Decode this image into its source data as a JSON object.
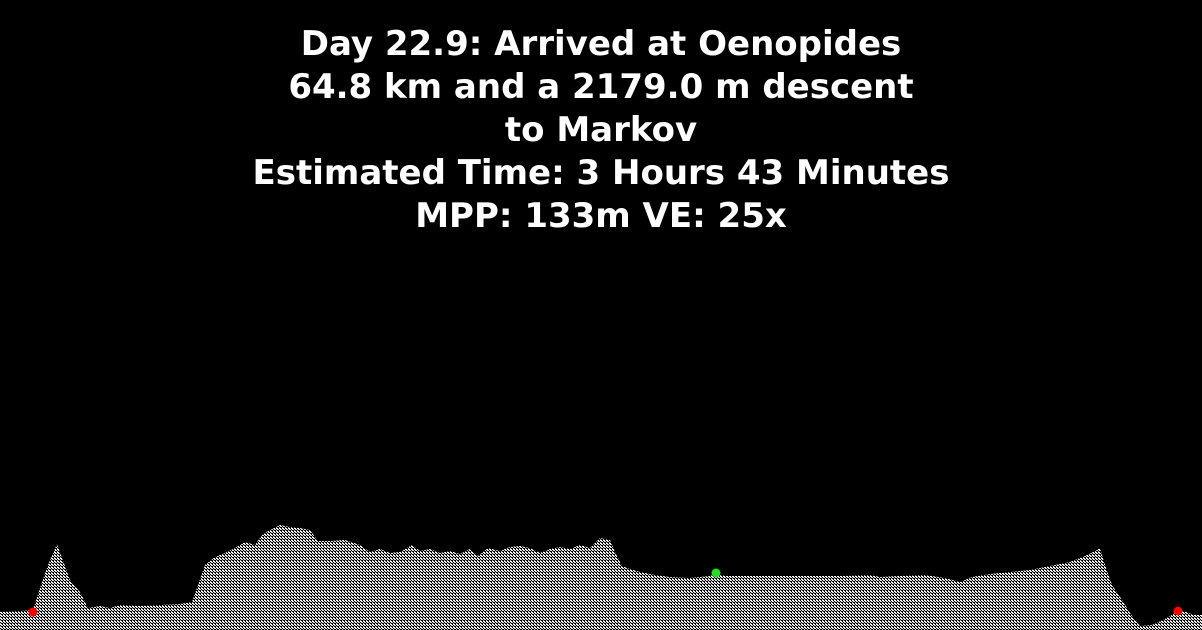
{
  "header": {
    "title": "Day 22.9: Arrived at Oenopides",
    "distance_line": "64.8 km and a 2179.0 m descent",
    "destination_line": "to Markov",
    "time_line": "Estimated Time: 3 Hours 43 Minutes",
    "scale_line": "MPP: 133m VE: 25x"
  },
  "colors": {
    "background": "#000000",
    "terrain": "#ffffff",
    "endpoint_markers": "#ff0000",
    "current_marker": "#22dd22"
  },
  "profile": {
    "markers": [
      {
        "name": "start",
        "color": "red",
        "position_fraction": 0.025
      },
      {
        "name": "current",
        "color": "green",
        "position_fraction": 0.595
      },
      {
        "name": "end",
        "color": "red",
        "position_fraction": 0.978
      }
    ]
  }
}
